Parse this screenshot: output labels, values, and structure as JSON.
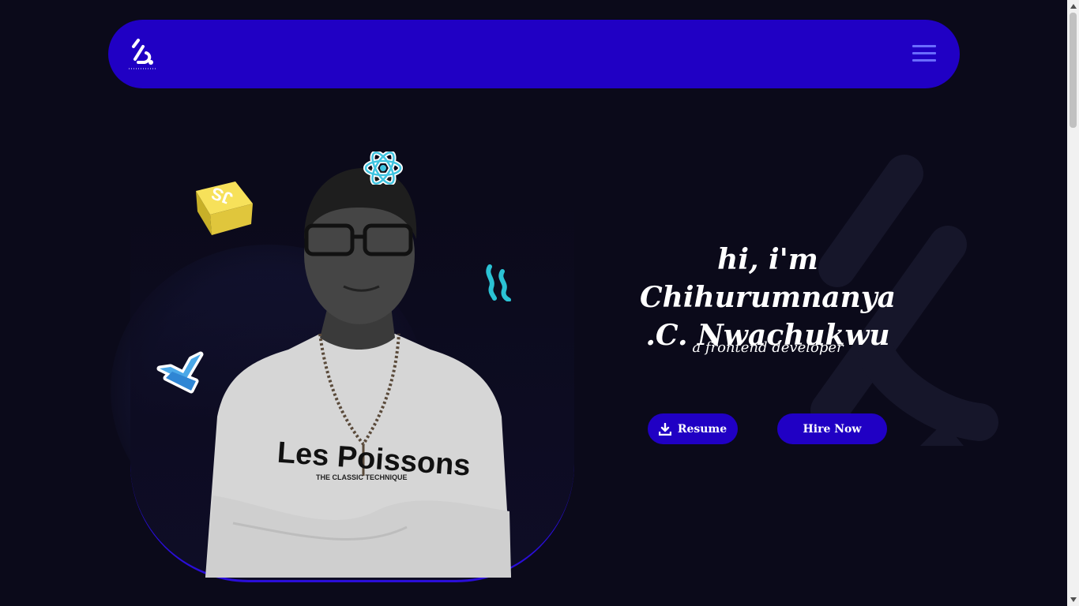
{
  "nav": {
    "logo_icon": "logo-icon",
    "menu_icon": "hamburger-menu-icon"
  },
  "hero": {
    "title_line1": "hi, i'm Chihurumnanya",
    "title_line2": ".C. Nwachukwu",
    "subtitle": "a frontend developer",
    "resume_label": "Resume",
    "hire_label": "Hire Now"
  },
  "decorations": {
    "js_label": "JS",
    "icons": [
      "javascript-icon",
      "react-icon",
      "sass-icon",
      "vue-icon"
    ]
  },
  "colors": {
    "background": "#0b0a1a",
    "accent": "#2000c4",
    "menu_lines": "#6a6cff",
    "text": "#ffffff"
  }
}
